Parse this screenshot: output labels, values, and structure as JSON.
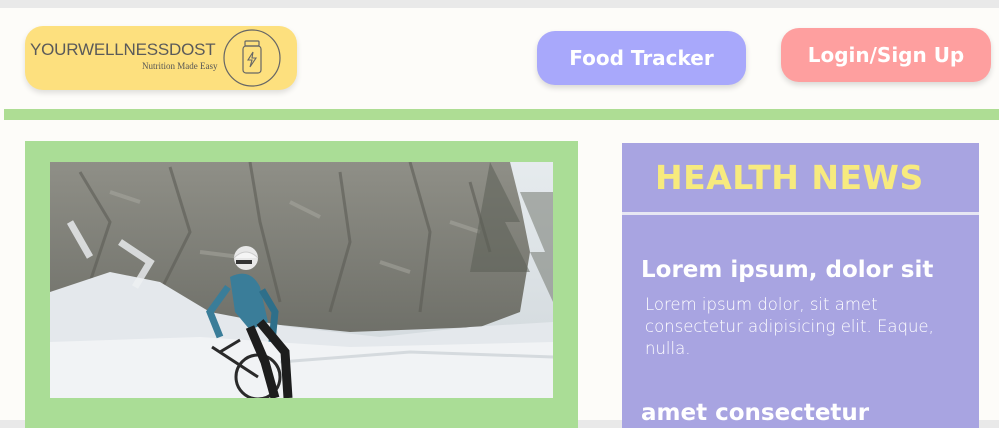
{
  "header": {
    "logo": {
      "title": "YOURWELLNESSDOST",
      "tagline": "Nutrition Made Easy",
      "badge_icon": "supplement-bottle-icon"
    },
    "nav": {
      "food_tracker_label": "Food Tracker",
      "login_label": "Login/Sign Up"
    }
  },
  "hero": {
    "image_icon": "cyclist-snow-photo"
  },
  "news": {
    "heading": "HEALTH NEWS",
    "articles": [
      {
        "title": "Lorem ipsum, dolor sit",
        "body": "Lorem ipsum dolor, sit amet consectetur adipisicing elit. Eaque, nulla."
      },
      {
        "title": "amet consectetur"
      }
    ]
  },
  "colors": {
    "logo_bg": "#fde07e",
    "food_tracker_bg": "#a8a8fb",
    "login_bg": "#fe9f9f",
    "accent_green": "#aedd94",
    "news_bg": "#a8a4e1",
    "news_heading": "#f7ea7e"
  }
}
